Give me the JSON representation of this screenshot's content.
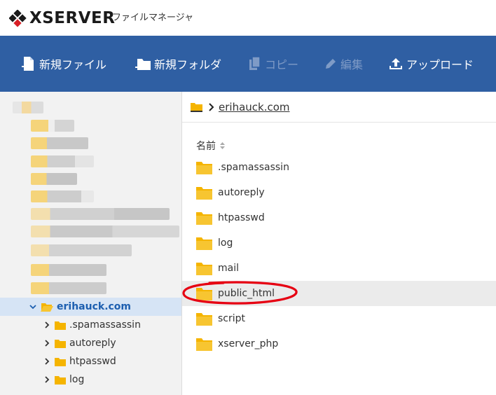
{
  "header": {
    "logo_text": "XSERVER",
    "app_name": "ファイルマネージャ"
  },
  "toolbar": {
    "new_file": "新規ファイル",
    "new_folder": "新規フォルダ",
    "copy": "コピー",
    "edit": "編集",
    "upload": "アップロード"
  },
  "tree": {
    "current_domain": "erihauck.com",
    "children": [
      ".spamassassin",
      "autoreply",
      "htpasswd",
      "log"
    ]
  },
  "breadcrumb": {
    "current": "erihauck.com"
  },
  "list": {
    "column_name": "名前",
    "items": [
      ".spamassassin",
      "autoreply",
      "htpasswd",
      "log",
      "mail",
      "public_html",
      "script",
      "xserver_php"
    ]
  },
  "colors": {
    "toolbar_bg": "#2f5fa3",
    "folder": "#f5b400",
    "selected_bg": "#d6e4f5",
    "annotation": "#e60012"
  }
}
